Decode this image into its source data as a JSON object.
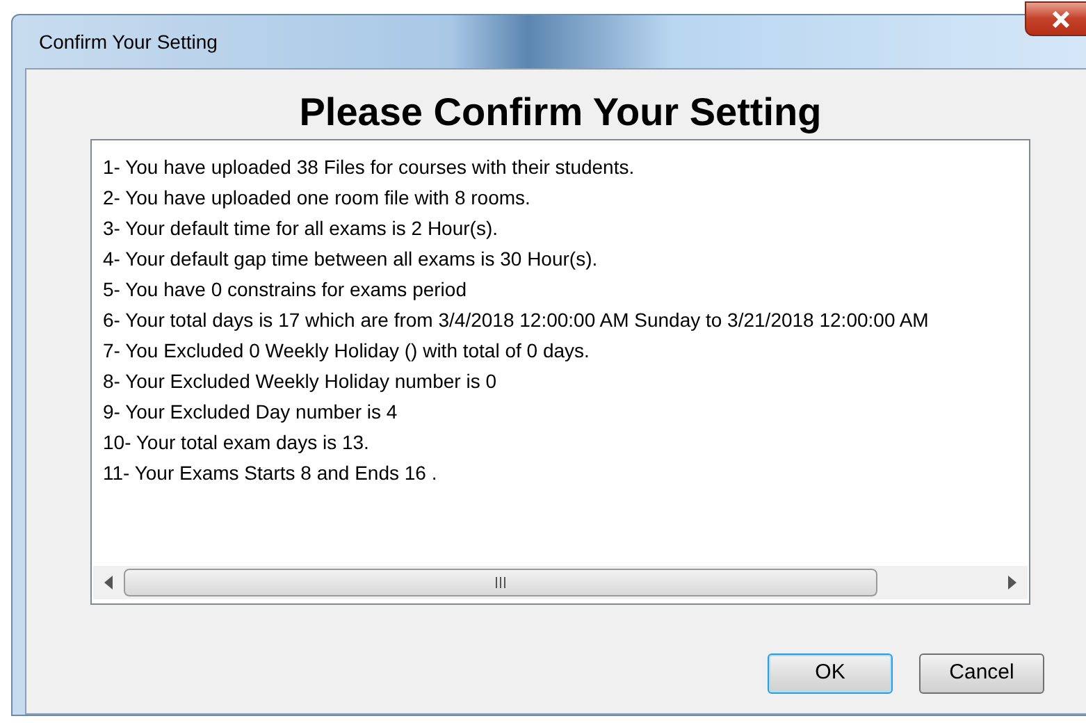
{
  "window": {
    "title": "Confirm Your Setting"
  },
  "heading": "Please Confirm Your Setting",
  "summary_lines": [
    "1-  You have uploaded 38  Files for courses with their students.",
    "2-  You have uploaded one room file with 8 rooms.",
    "3-  Your default time for all exams is 2 Hour(s).",
    "4-  Your default gap time between all exams is 30 Hour(s).",
    "5-  You have 0 constrains for exams period",
    "6-  Your total days is 17 which are from 3/4/2018 12:00:00 AM Sunday to 3/21/2018 12:00:00 AM",
    "7-  You Excluded 0 Weekly Holiday () with total of  0 days.",
    "8-  Your Excluded Weekly Holiday number is  0",
    "9-  Your Excluded Day number is  4",
    "10-  Your total exam days is 13.",
    "11-  Your Exams Starts  8 and Ends  16 ."
  ],
  "buttons": [
    {
      "label": "OK",
      "selected": true
    },
    {
      "label": "Cancel",
      "selected": false
    }
  ]
}
